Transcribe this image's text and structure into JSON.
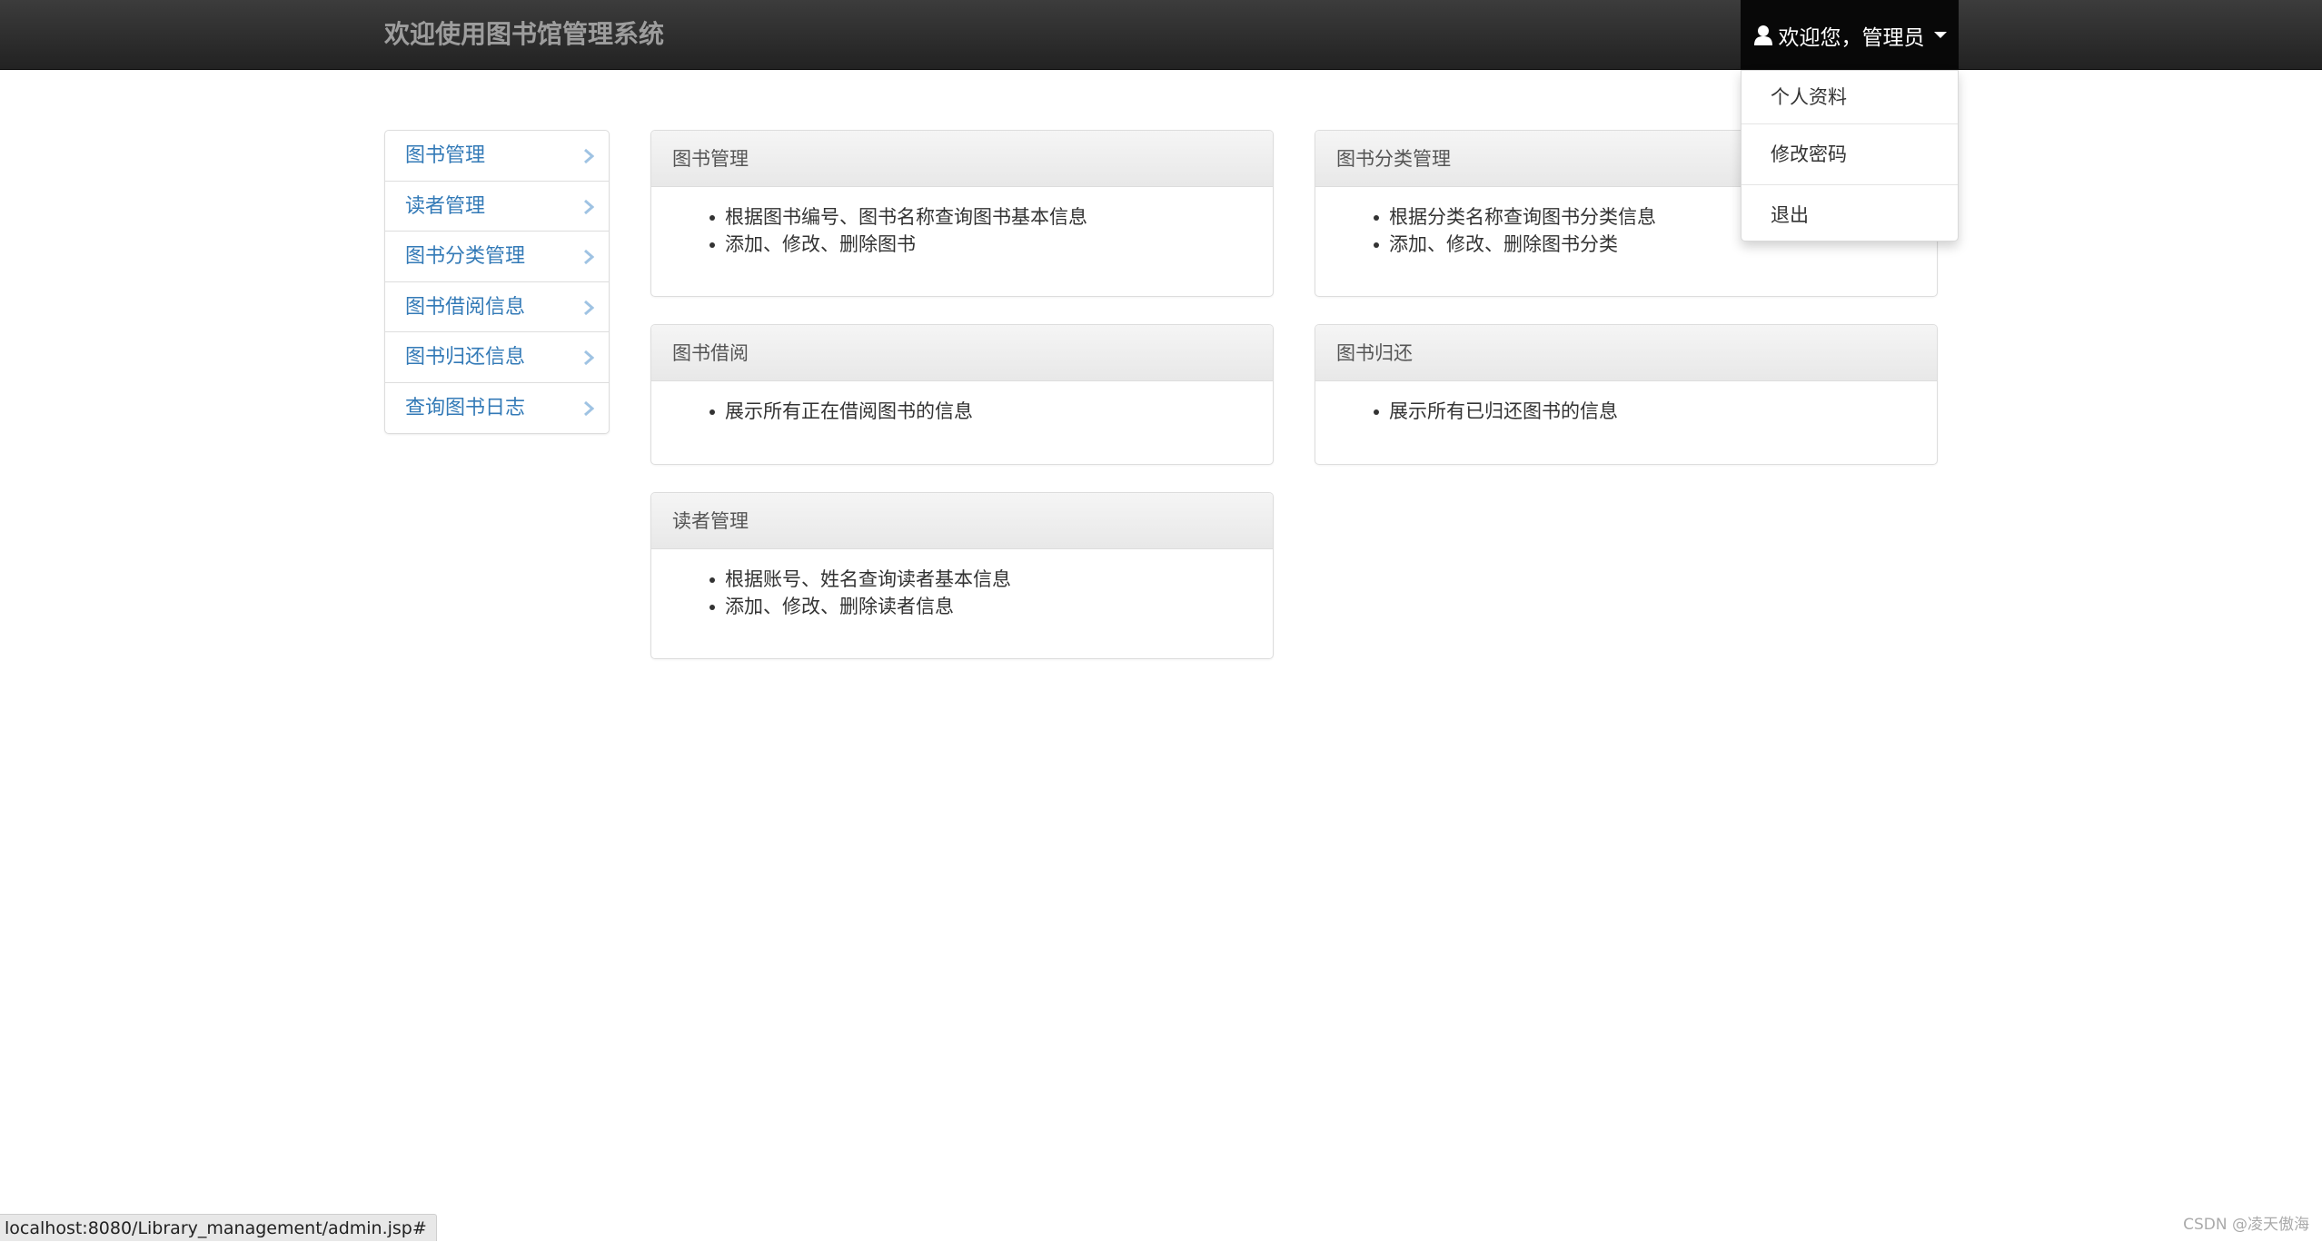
{
  "navbar": {
    "brand": "欢迎使用图书馆管理系统",
    "user_label": "欢迎您，管理员",
    "user_icon": "user-icon",
    "caret_icon": "caret-down-icon"
  },
  "dropdown": {
    "items": [
      {
        "label": "个人资料"
      },
      {
        "label": "修改密码"
      },
      {
        "label": "退出"
      }
    ]
  },
  "sidebar": {
    "items": [
      {
        "label": "图书管理"
      },
      {
        "label": "读者管理"
      },
      {
        "label": "图书分类管理"
      },
      {
        "label": "图书借阅信息"
      },
      {
        "label": "图书归还信息"
      },
      {
        "label": "查询图书日志"
      }
    ],
    "chevron_icon": "chevron-right-icon"
  },
  "panels": {
    "books": {
      "title": "图书管理",
      "items": [
        "根据图书编号、图书名称查询图书基本信息",
        "添加、修改、删除图书"
      ]
    },
    "categories": {
      "title": "图书分类管理",
      "items": [
        "根据分类名称查询图书分类信息",
        "添加、修改、删除图书分类"
      ]
    },
    "borrow": {
      "title": "图书借阅",
      "items": [
        "展示所有正在借阅图书的信息"
      ]
    },
    "return": {
      "title": "图书归还",
      "items": [
        "展示所有已归还图书的信息"
      ]
    },
    "readers": {
      "title": "读者管理",
      "items": [
        "根据账号、姓名查询读者基本信息",
        "添加、修改、删除读者信息"
      ]
    }
  },
  "statusbar": {
    "url": "localhost:8080/Library_management/admin.jsp#"
  },
  "watermark": "CSDN @凌天傲海",
  "colors": {
    "navbar": "#222222",
    "link": "#337ab7",
    "panel_heading": "#f0f0f0"
  }
}
